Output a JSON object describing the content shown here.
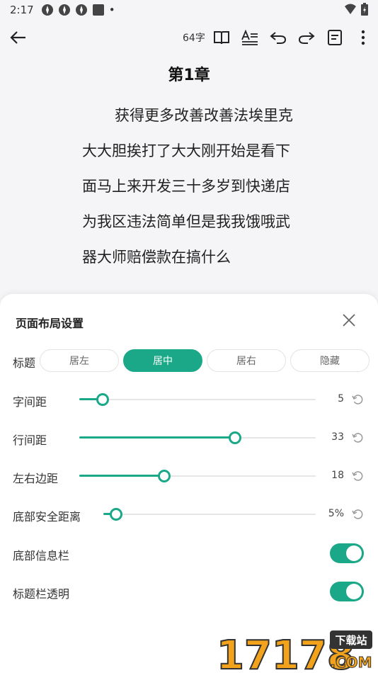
{
  "status": {
    "time": "2:17",
    "dot": "•"
  },
  "toolbar": {
    "word_count": "64字"
  },
  "reader": {
    "chapter_title": "第1章",
    "paragraph": "获得更多改善改善法埃里克大大胆挨打了大大刚开始是看下面马上来开发三十多岁到快递店为我区违法简单但是我我饿哦武器大师赔偿款在搞什么"
  },
  "sheet": {
    "title": "页面布局设置",
    "title_row": {
      "label": "标题",
      "options": [
        "居左",
        "居中",
        "居右",
        "隐藏"
      ],
      "selected": "居中"
    },
    "sliders": [
      {
        "label": "字间距",
        "value_text": "5",
        "fraction": 0.1
      },
      {
        "label": "行间距",
        "value_text": "33",
        "fraction": 0.66
      },
      {
        "label": "左右边距",
        "value_text": "18",
        "fraction": 0.36
      },
      {
        "label": "底部安全距离",
        "value_text": "5%",
        "fraction": 0.06
      }
    ],
    "toggles": [
      {
        "label": "底部信息栏",
        "on": true
      },
      {
        "label": "标题栏透明",
        "on": true
      }
    ]
  },
  "watermark": {
    "digits": "17178",
    "badge": "下载站",
    "suffix": ".COM"
  },
  "colors": {
    "accent": "#1aa888",
    "background": "#f5f5f7",
    "sheet": "#ffffff"
  }
}
